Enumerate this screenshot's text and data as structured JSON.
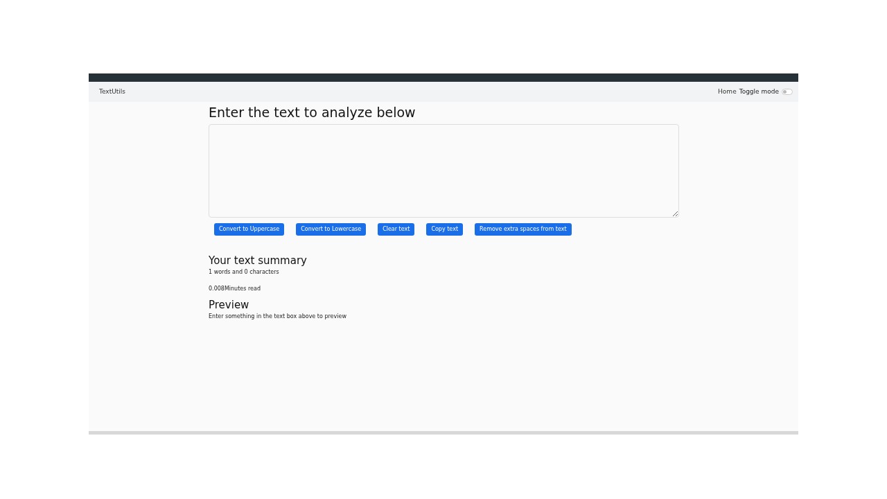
{
  "navbar": {
    "brand": "TextUtils",
    "links": [
      {
        "label": "Home"
      }
    ],
    "toggle": {
      "label": "Toggle mode",
      "on": false
    }
  },
  "form": {
    "heading": "Enter the text to analyze below",
    "buttons": [
      "Convert to Uppercase",
      "Convert to Lowercase",
      "Clear text",
      "Copy text",
      "Remove extra spaces from text"
    ]
  },
  "summary": {
    "heading": "Your text summary",
    "words_line": "1 words and 0 characters",
    "read_line": "0.008Minutes read"
  },
  "preview": {
    "heading": "Preview",
    "text": "Enter something in the text box above to preview"
  }
}
